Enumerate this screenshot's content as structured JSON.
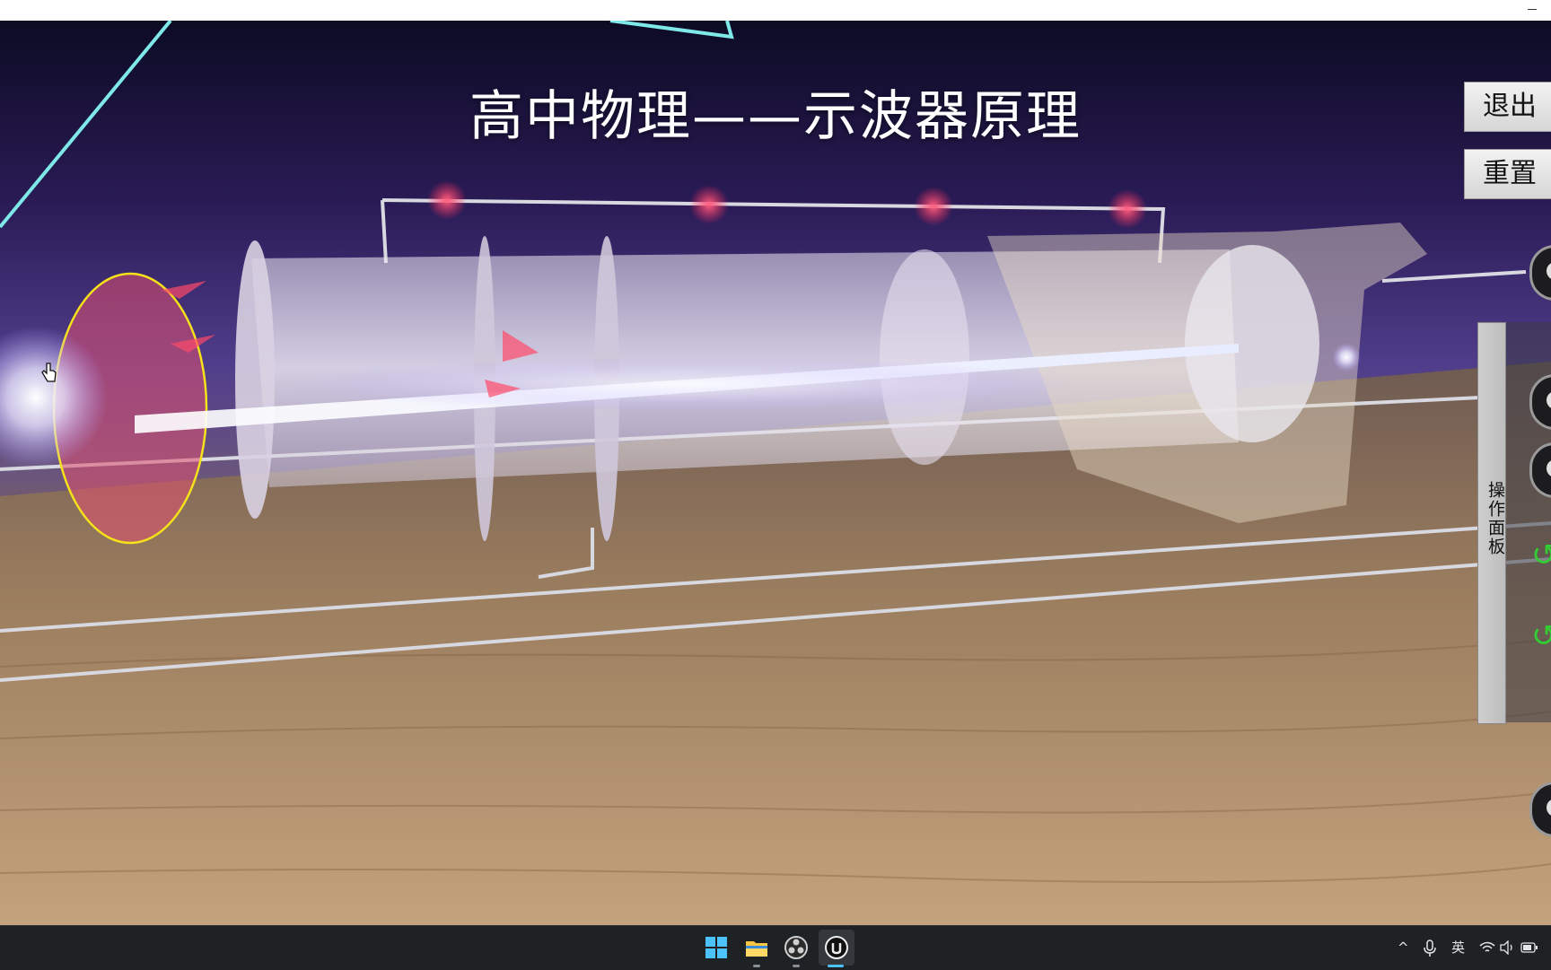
{
  "window": {
    "minimize_symbol": "–"
  },
  "simulation": {
    "title": "高中物理——示波器原理",
    "buttons": {
      "exit": "退出",
      "reset": "重置"
    },
    "panel": {
      "tab_label": "操作面板"
    }
  },
  "taskbar": {
    "apps": [
      {
        "icon": "windows-start-icon",
        "active": false
      },
      {
        "icon": "file-explorer-icon",
        "active": false
      },
      {
        "icon": "obs-icon",
        "active": false
      },
      {
        "icon": "unreal-engine-icon",
        "active": true
      }
    ],
    "tray": {
      "expand": "^",
      "ime": "英",
      "icons": [
        "microphone-icon",
        "wifi-icon",
        "speaker-icon",
        "battery-icon"
      ]
    }
  },
  "colors": {
    "beam": "#ffffff",
    "accent_red": "#ff2a5a",
    "selection_outline": "#f5e21a",
    "wire": "#d8d8e0",
    "laser_cyan": "#7fe8e8"
  }
}
